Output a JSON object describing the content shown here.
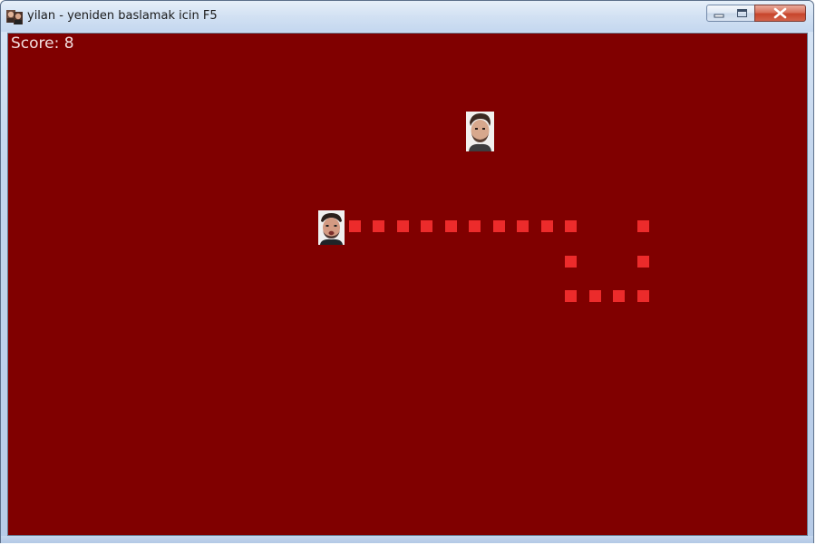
{
  "window": {
    "title": "yilan - yeniden baslamak icin F5",
    "controls": [
      "minimize",
      "maximize",
      "close"
    ],
    "app_icon": "two-faces-icon"
  },
  "game": {
    "background_color": "#800000",
    "score_label": "Score: 8",
    "snake_color": "#ec2b2b",
    "snake_head": "face-photo-sprite",
    "food": "face-photo-sprite",
    "snake_segment_count": 16
  }
}
